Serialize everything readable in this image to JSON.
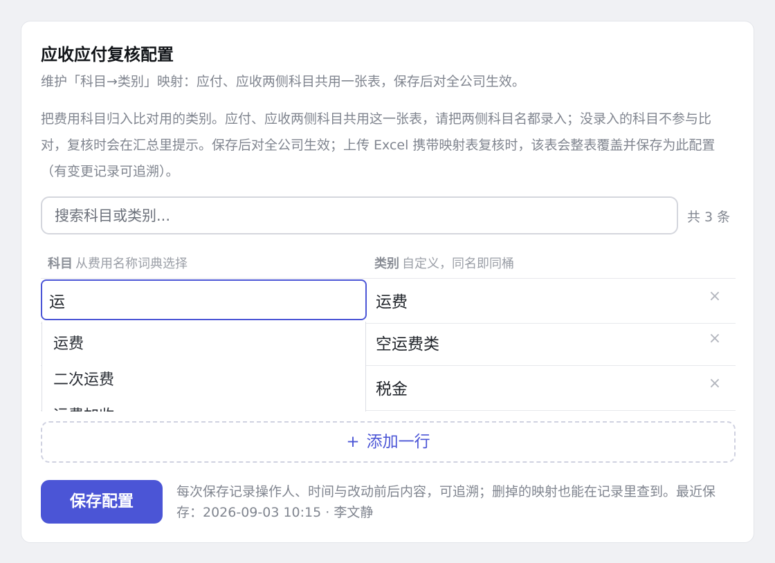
{
  "page": {
    "title": "应收应付复核配置",
    "subtitle": "维护「科目→类别」映射：应付、应收两侧科目共用一张表，保存后对全公司生效。",
    "description": "把费用科目归入比对用的类别。应付、应收两侧科目共用这一张表，请把两侧科目名都录入；没录入的科目不参与比对，复核时会在汇总里提示。保存后对全公司生效；上传 Excel 携带映射表复核时，该表会整表覆盖并保存为此配置（有变更记录可追溯）。"
  },
  "search": {
    "placeholder": "搜索科目或类别...",
    "count_text": "共 3 条"
  },
  "columns": {
    "subject_label": "科目",
    "subject_hint": "从费用名称词典选择",
    "category_label": "类别",
    "category_hint": "自定义，同名即同桶"
  },
  "rows": [
    {
      "subject": "运",
      "category": "运费"
    },
    {
      "subject": "",
      "category": "空运费类"
    },
    {
      "subject": "",
      "category": "税金"
    }
  ],
  "dropdown": {
    "options": [
      "运费",
      "二次运费",
      "运费加收"
    ]
  },
  "remove_icon": "×",
  "add_row": {
    "icon": "+",
    "label": "添加一行"
  },
  "save": {
    "button_label": "保存配置",
    "note": "每次保存记录操作人、时间与改动前后内容，可追溯；删掉的映射也能在记录里查到。最近保存：2026-09-03 10:15 · 李文静"
  },
  "colors": {
    "accent": "#4b55d6",
    "page_background": "#f0f1f4",
    "muted_text": "#80858f"
  }
}
